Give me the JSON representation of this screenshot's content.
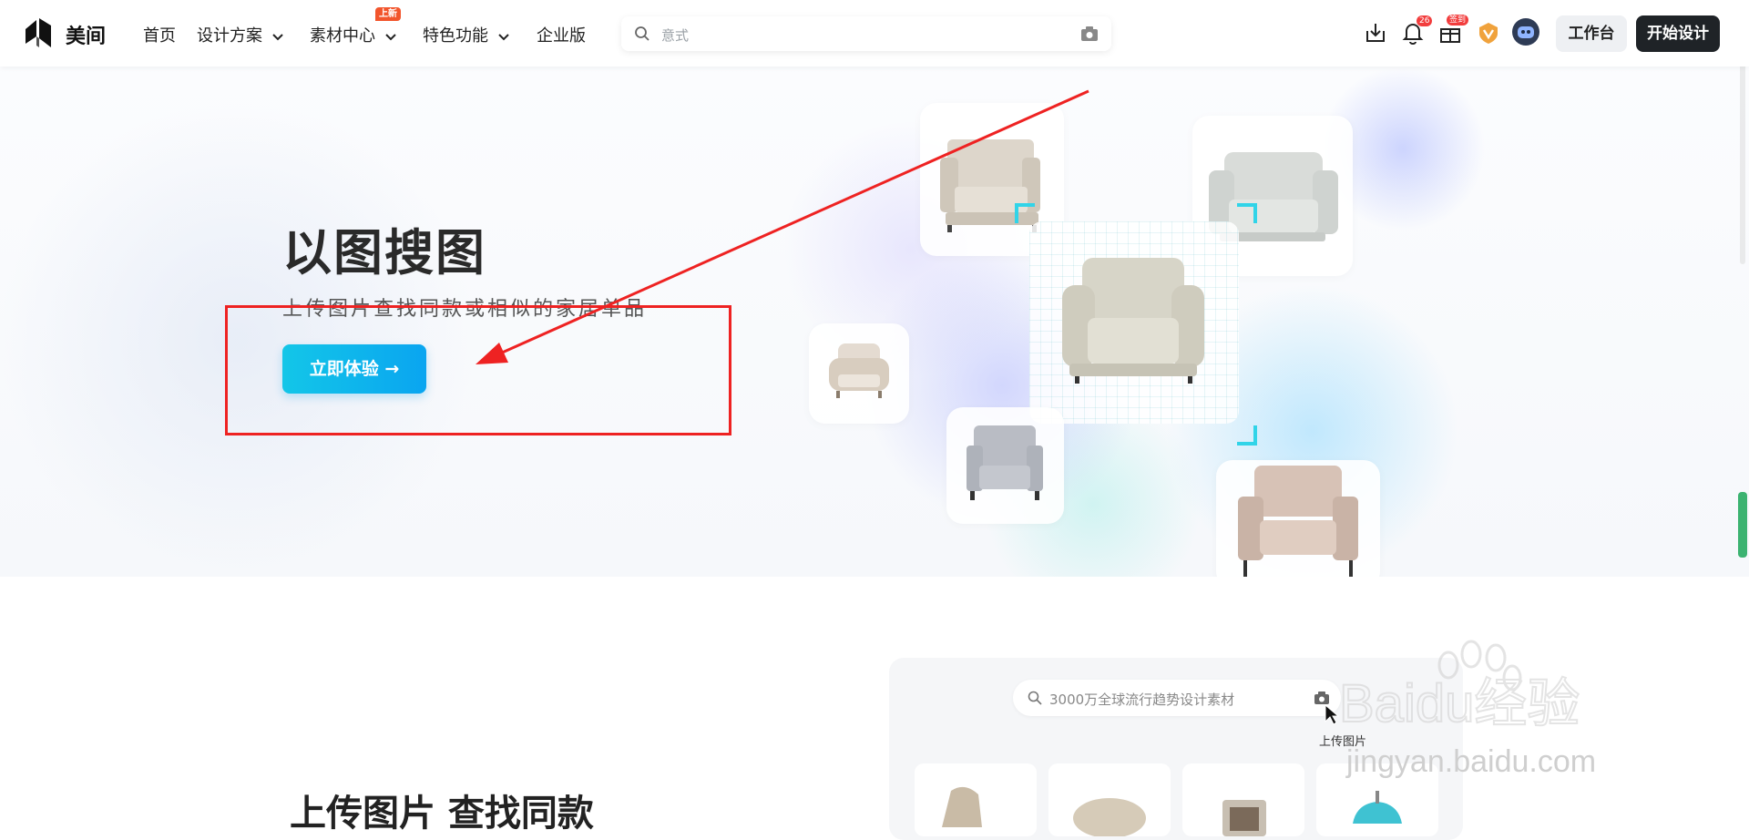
{
  "header": {
    "logo_text": "美间",
    "nav": {
      "home": "首页",
      "design": "设计方案",
      "material": "素材中心",
      "material_badge": "上新",
      "features": "特色功能",
      "enterprise": "企业版"
    },
    "search_placeholder": "意式",
    "notification_count": "26",
    "sign_badge": "签到",
    "workbench_label": "工作台",
    "start_label": "开始设计"
  },
  "hero": {
    "title": "以图搜图",
    "subtitle": "上传图片查找同款或相似的家居单品",
    "button_label": "立即体验 →"
  },
  "lower": {
    "title": "上传图片 查找同款",
    "search_placeholder": "3000万全球流行趋势设计素材",
    "tooltip": "上传图片"
  },
  "watermark": {
    "brand": "Baidu经验",
    "url": "jingyan.baidu.com"
  },
  "colors": {
    "accent_cyan": "#13c6e8",
    "annotation_red": "#ee2222",
    "dark_button": "#1f2327"
  }
}
